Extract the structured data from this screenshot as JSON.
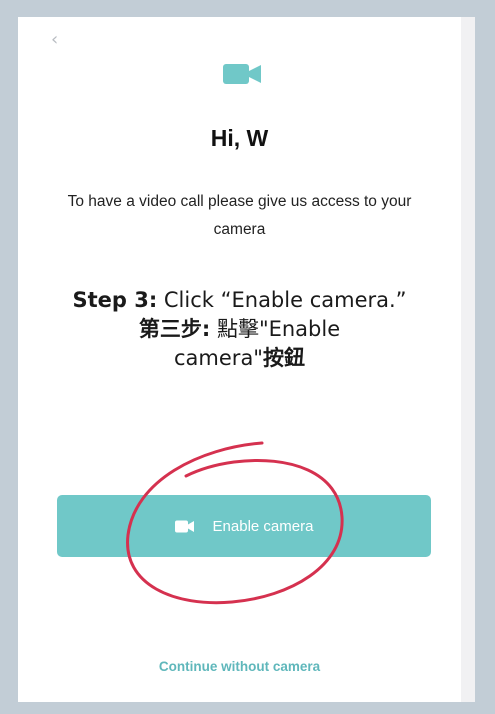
{
  "header": {
    "back_glyph": "‹",
    "camera_icon": "video-camera-icon"
  },
  "greeting": "Hi, W",
  "description": "To have a video call please give us access to your camera",
  "instruction": {
    "step_label": "Step 3:",
    "step_text": " Click “Enable camera.”",
    "zh_label": "第三步:",
    "zh_text_1": " 點擊\"Enable",
    "zh_text_2": "camera\"",
    "zh_text_3": "按鈕"
  },
  "enable_button": {
    "label": "Enable camera",
    "icon": "video-camera-icon"
  },
  "continue_link": "Continue without camera",
  "colors": {
    "accent": "#70c8c8",
    "link": "#5fb7bb",
    "annotation_circle": "#d5314f",
    "frame": "#c2cdd6"
  }
}
